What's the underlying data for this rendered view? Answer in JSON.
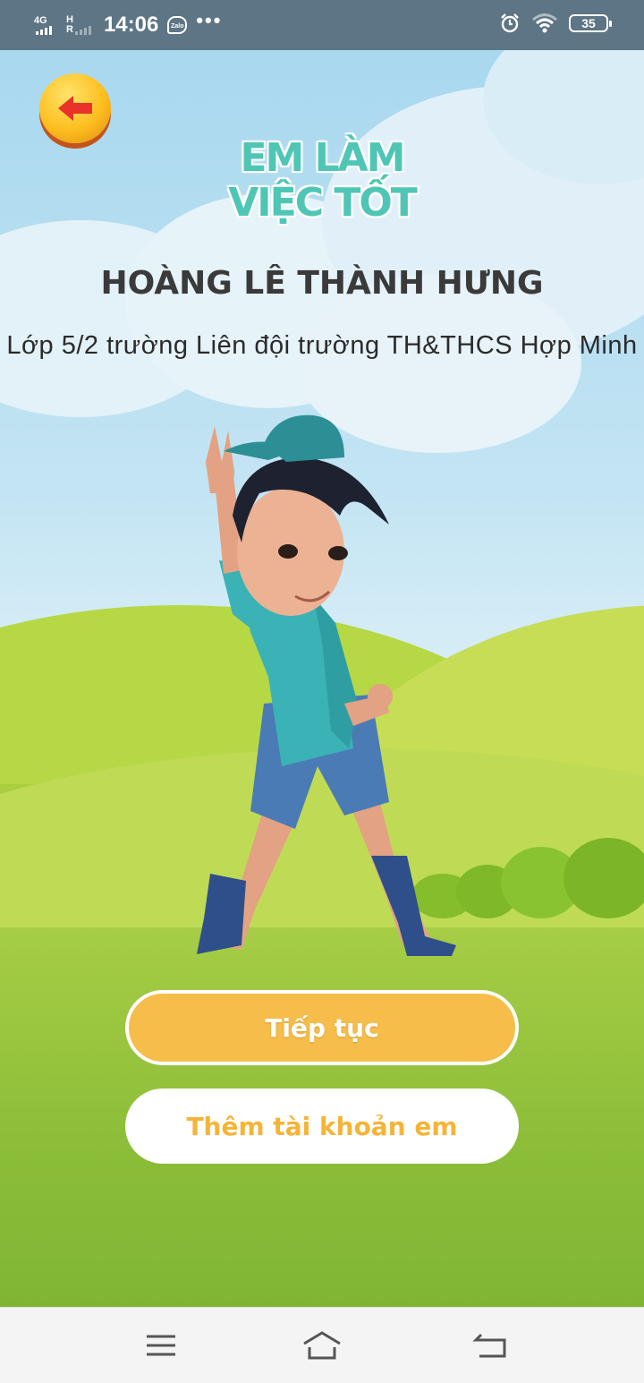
{
  "status_bar": {
    "net1": "4G",
    "net2_top": "H",
    "net2_bottom": "R",
    "time": "14:06",
    "zalo": "Zalo",
    "more": "•••",
    "battery": "35"
  },
  "header": {
    "title_line1": "EM LÀM",
    "title_line2": "VIỆC TỐT"
  },
  "profile": {
    "name": "HOÀNG LÊ THÀNH HƯNG",
    "class_info": "Lớp  5/2 trường Liên đội trường TH&THCS Hợp Minh"
  },
  "actions": {
    "continue_label": "Tiếp tục",
    "add_account_label": "Thêm tài khoản em"
  },
  "icons": {
    "back": "back-arrow-icon",
    "menu": "menu-icon",
    "home": "home-icon",
    "return": "return-icon"
  },
  "colors": {
    "primary_button": "#f7bd4a",
    "title_teal": "#4fc6b5",
    "grass": "#8fc43c",
    "sky": "#a9d8ef"
  }
}
